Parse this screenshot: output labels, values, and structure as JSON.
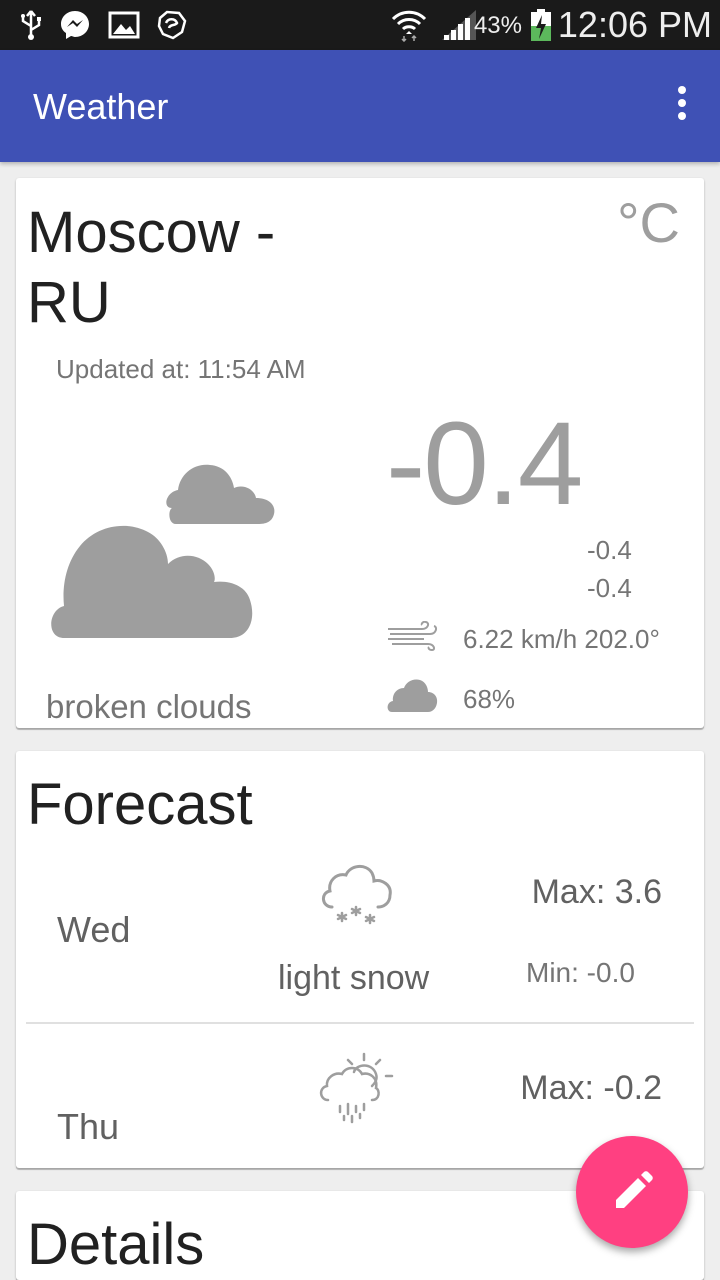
{
  "status_bar": {
    "battery_percent": "43%",
    "time": "12:06 PM",
    "icons": [
      "usb-icon",
      "messenger-icon",
      "gallery-icon",
      "app-icon",
      "wifi-icon",
      "signal-icon",
      "battery-charging-icon"
    ]
  },
  "app_bar": {
    "title": "Weather",
    "overflow_icon": "more-vert-icon"
  },
  "current": {
    "city": "Moscow - RU",
    "unit": "°C",
    "updated_label": "Updated at: 11:54 AM",
    "temperature": "-0.4",
    "temp_max": "-0.4",
    "temp_min": "-0.4",
    "wind": "6.22 km/h 202.0°",
    "humidity": "68%",
    "description": "broken clouds",
    "icon": "broken-clouds-icon"
  },
  "forecast": {
    "title": "Forecast",
    "days": [
      {
        "day": "Wed",
        "description": "light snow",
        "max": "Max: 3.6",
        "min": "Min: -0.0",
        "icon": "snow-cloud-icon"
      },
      {
        "day": "Thu",
        "description": "",
        "max": "Max: -0.2",
        "min": "",
        "icon": "sun-rain-cloud-icon"
      }
    ]
  },
  "details": {
    "title": "Details"
  },
  "fab": {
    "icon": "edit-pencil-icon"
  },
  "colors": {
    "primary": "#3f51b5",
    "accent": "#ff4081",
    "status_bar": "#1a1a1a"
  }
}
